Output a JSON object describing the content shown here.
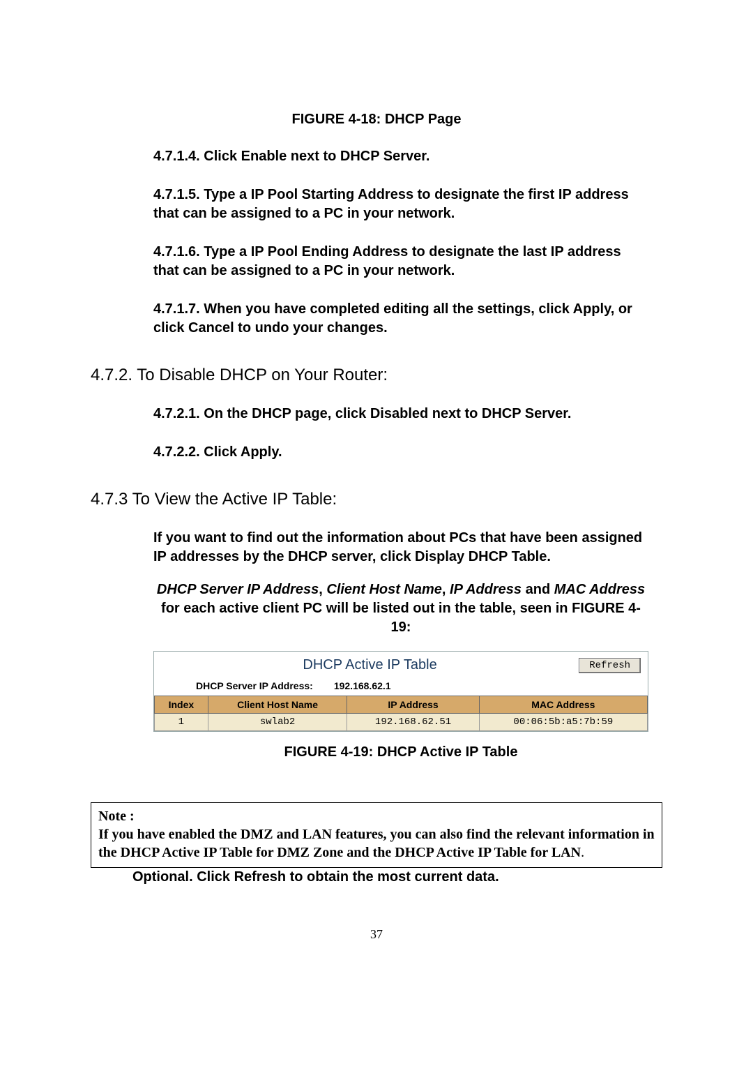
{
  "figure18_caption": "FIGURE 4-18: DHCP Page",
  "steps1": {
    "s4": "4.7.1.4. Click Enable next to DHCP Server.",
    "s5": "4.7.1.5. Type a IP Pool Starting Address to designate the first IP address that can be assigned to a PC in your network.",
    "s6": "4.7.1.6. Type a IP Pool Ending Address to designate the last IP address that can be assigned to a PC in your network.",
    "s7": "4.7.1.7. When you have completed editing all the settings, click Apply, or click Cancel to undo your changes."
  },
  "heading472": "4.7.2. To Disable DHCP on Your Router:",
  "steps2": {
    "s1": "4.7.2.1. On the DHCP page, click Disabled next to DHCP Server.",
    "s2": "4.7.2.2. Click Apply."
  },
  "heading473": "4.7.3 To View the Active IP Table:",
  "para473a": "If you want to find out the information about PCs that have been assigned IP addresses by the DHCP server, click Display DHCP Table.",
  "para473b_prefix": "",
  "para473b_italics": [
    "DHCP Server IP Address",
    "Client Host Name",
    "IP Address",
    "MAC Address"
  ],
  "para473b_joins": [
    ", ",
    ", ",
    " and "
  ],
  "para473b_suffix": " for each active client PC will be listed out in the table, seen in FIGURE 4-19:",
  "figure19": {
    "title": "DHCP Active IP Table",
    "refresh": "Refresh",
    "server_label": "DHCP Server IP Address:",
    "server_ip": "192.168.62.1",
    "headers": [
      "Index",
      "Client Host Name",
      "IP Address",
      "MAC Address"
    ],
    "rows": [
      {
        "index": "1",
        "host": "swlab2",
        "ip": "192.168.62.51",
        "mac": "00:06:5b:a5:7b:59"
      }
    ]
  },
  "figure19_caption": "FIGURE 4-19: DHCP Active IP Table",
  "note": {
    "label": "Note :",
    "body": "If you have enabled the DMZ and LAN features, you can also find the relevant information in the DHCP Active IP Table for DMZ Zone and the DHCP Active IP Table for LAN",
    "trail": "."
  },
  "after_note": "Optional. Click Refresh to obtain the most current data.",
  "pagenum": "37"
}
